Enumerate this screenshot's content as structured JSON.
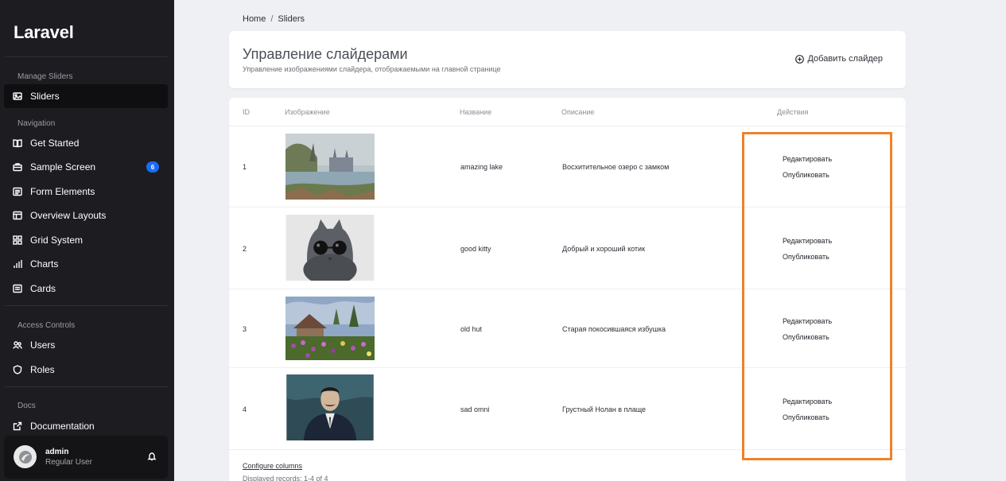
{
  "sidebar": {
    "brand": "Laravel",
    "sections": {
      "manage": "Manage Sliders",
      "navigation": "Navigation",
      "access": "Access Controls",
      "docs": "Docs"
    },
    "items": {
      "sliders": "Sliders",
      "get_started": "Get Started",
      "sample_screen": "Sample Screen",
      "sample_badge": "6",
      "form_elements": "Form Elements",
      "overview_layouts": "Overview Layouts",
      "grid_system": "Grid System",
      "charts": "Charts",
      "cards": "Cards",
      "users": "Users",
      "roles": "Roles",
      "documentation": "Documentation"
    },
    "user": {
      "name": "admin",
      "role": "Regular User"
    }
  },
  "breadcrumb": {
    "home": "Home",
    "separator": "/",
    "current": "Sliders"
  },
  "header": {
    "title": "Управление слайдерами",
    "subtitle": "Управление изображениями слайдера, отображаемыми на главной странице",
    "add_button": "Добавить слайдер"
  },
  "table": {
    "columns": {
      "id": "ID",
      "image": "Изображение",
      "name": "Название",
      "description": "Описание",
      "actions": "Действия"
    },
    "rows": [
      {
        "id": "1",
        "name": "amazing lake",
        "description": "Восхитительное озеро с замком",
        "edit": "Редактировать",
        "publish": "Опубликовать",
        "image_icon": "painting-lake-castle"
      },
      {
        "id": "2",
        "name": "good kitty",
        "description": "Добрый и хороший котик",
        "edit": "Редактировать",
        "publish": "Опубликовать",
        "image_icon": "cat-with-sunglasses"
      },
      {
        "id": "3",
        "name": "old hut",
        "description": "Старая покосившаяся избушка",
        "edit": "Редактировать",
        "publish": "Опубликовать",
        "image_icon": "painting-hut-flowers"
      },
      {
        "id": "4",
        "name": "sad omni",
        "description": "Грустный Нолан в плаще",
        "edit": "Редактировать",
        "publish": "Опубликовать",
        "image_icon": "cartoon-man-in-coat"
      }
    ],
    "configure_columns": "Configure columns",
    "displayed_records": "Displayed records: 1-4 of 4"
  },
  "colors": {
    "sidebar_bg": "#1c1c21",
    "badge": "#1a6cf5",
    "highlight": "#f0812a",
    "page_bg": "#eef0f3"
  }
}
